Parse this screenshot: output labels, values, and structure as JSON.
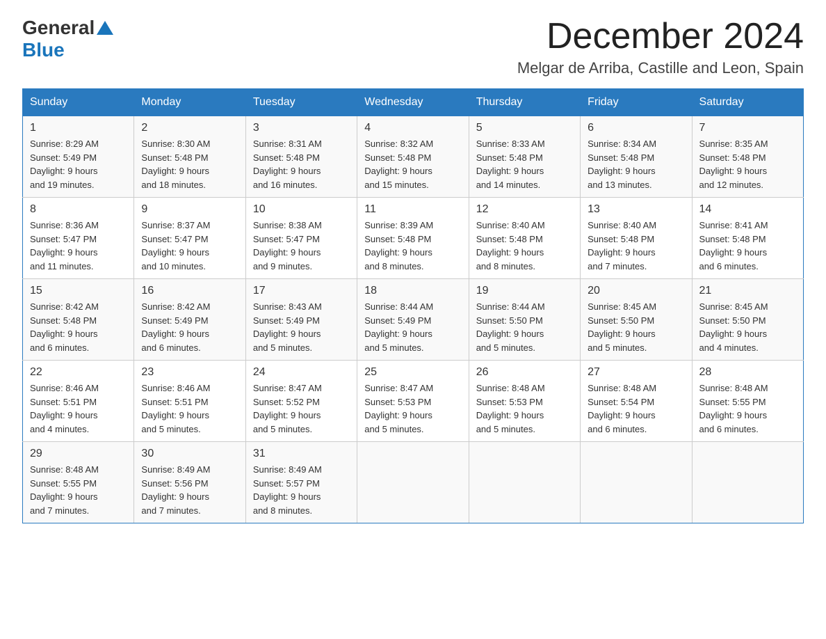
{
  "header": {
    "logo_general": "General",
    "logo_blue": "Blue",
    "month_title": "December 2024",
    "location": "Melgar de Arriba, Castille and Leon, Spain"
  },
  "days_of_week": [
    "Sunday",
    "Monday",
    "Tuesday",
    "Wednesday",
    "Thursday",
    "Friday",
    "Saturday"
  ],
  "weeks": [
    [
      {
        "day": "1",
        "sunrise": "8:29 AM",
        "sunset": "5:49 PM",
        "daylight": "9 hours and 19 minutes."
      },
      {
        "day": "2",
        "sunrise": "8:30 AM",
        "sunset": "5:48 PM",
        "daylight": "9 hours and 18 minutes."
      },
      {
        "day": "3",
        "sunrise": "8:31 AM",
        "sunset": "5:48 PM",
        "daylight": "9 hours and 16 minutes."
      },
      {
        "day": "4",
        "sunrise": "8:32 AM",
        "sunset": "5:48 PM",
        "daylight": "9 hours and 15 minutes."
      },
      {
        "day": "5",
        "sunrise": "8:33 AM",
        "sunset": "5:48 PM",
        "daylight": "9 hours and 14 minutes."
      },
      {
        "day": "6",
        "sunrise": "8:34 AM",
        "sunset": "5:48 PM",
        "daylight": "9 hours and 13 minutes."
      },
      {
        "day": "7",
        "sunrise": "8:35 AM",
        "sunset": "5:48 PM",
        "daylight": "9 hours and 12 minutes."
      }
    ],
    [
      {
        "day": "8",
        "sunrise": "8:36 AM",
        "sunset": "5:47 PM",
        "daylight": "9 hours and 11 minutes."
      },
      {
        "day": "9",
        "sunrise": "8:37 AM",
        "sunset": "5:47 PM",
        "daylight": "9 hours and 10 minutes."
      },
      {
        "day": "10",
        "sunrise": "8:38 AM",
        "sunset": "5:47 PM",
        "daylight": "9 hours and 9 minutes."
      },
      {
        "day": "11",
        "sunrise": "8:39 AM",
        "sunset": "5:48 PM",
        "daylight": "9 hours and 8 minutes."
      },
      {
        "day": "12",
        "sunrise": "8:40 AM",
        "sunset": "5:48 PM",
        "daylight": "9 hours and 8 minutes."
      },
      {
        "day": "13",
        "sunrise": "8:40 AM",
        "sunset": "5:48 PM",
        "daylight": "9 hours and 7 minutes."
      },
      {
        "day": "14",
        "sunrise": "8:41 AM",
        "sunset": "5:48 PM",
        "daylight": "9 hours and 6 minutes."
      }
    ],
    [
      {
        "day": "15",
        "sunrise": "8:42 AM",
        "sunset": "5:48 PM",
        "daylight": "9 hours and 6 minutes."
      },
      {
        "day": "16",
        "sunrise": "8:42 AM",
        "sunset": "5:49 PM",
        "daylight": "9 hours and 6 minutes."
      },
      {
        "day": "17",
        "sunrise": "8:43 AM",
        "sunset": "5:49 PM",
        "daylight": "9 hours and 5 minutes."
      },
      {
        "day": "18",
        "sunrise": "8:44 AM",
        "sunset": "5:49 PM",
        "daylight": "9 hours and 5 minutes."
      },
      {
        "day": "19",
        "sunrise": "8:44 AM",
        "sunset": "5:50 PM",
        "daylight": "9 hours and 5 minutes."
      },
      {
        "day": "20",
        "sunrise": "8:45 AM",
        "sunset": "5:50 PM",
        "daylight": "9 hours and 5 minutes."
      },
      {
        "day": "21",
        "sunrise": "8:45 AM",
        "sunset": "5:50 PM",
        "daylight": "9 hours and 4 minutes."
      }
    ],
    [
      {
        "day": "22",
        "sunrise": "8:46 AM",
        "sunset": "5:51 PM",
        "daylight": "9 hours and 4 minutes."
      },
      {
        "day": "23",
        "sunrise": "8:46 AM",
        "sunset": "5:51 PM",
        "daylight": "9 hours and 5 minutes."
      },
      {
        "day": "24",
        "sunrise": "8:47 AM",
        "sunset": "5:52 PM",
        "daylight": "9 hours and 5 minutes."
      },
      {
        "day": "25",
        "sunrise": "8:47 AM",
        "sunset": "5:53 PM",
        "daylight": "9 hours and 5 minutes."
      },
      {
        "day": "26",
        "sunrise": "8:48 AM",
        "sunset": "5:53 PM",
        "daylight": "9 hours and 5 minutes."
      },
      {
        "day": "27",
        "sunrise": "8:48 AM",
        "sunset": "5:54 PM",
        "daylight": "9 hours and 6 minutes."
      },
      {
        "day": "28",
        "sunrise": "8:48 AM",
        "sunset": "5:55 PM",
        "daylight": "9 hours and 6 minutes."
      }
    ],
    [
      {
        "day": "29",
        "sunrise": "8:48 AM",
        "sunset": "5:55 PM",
        "daylight": "9 hours and 7 minutes."
      },
      {
        "day": "30",
        "sunrise": "8:49 AM",
        "sunset": "5:56 PM",
        "daylight": "9 hours and 7 minutes."
      },
      {
        "day": "31",
        "sunrise": "8:49 AM",
        "sunset": "5:57 PM",
        "daylight": "9 hours and 8 minutes."
      },
      null,
      null,
      null,
      null
    ]
  ],
  "labels": {
    "sunrise": "Sunrise:",
    "sunset": "Sunset:",
    "daylight": "Daylight:"
  }
}
